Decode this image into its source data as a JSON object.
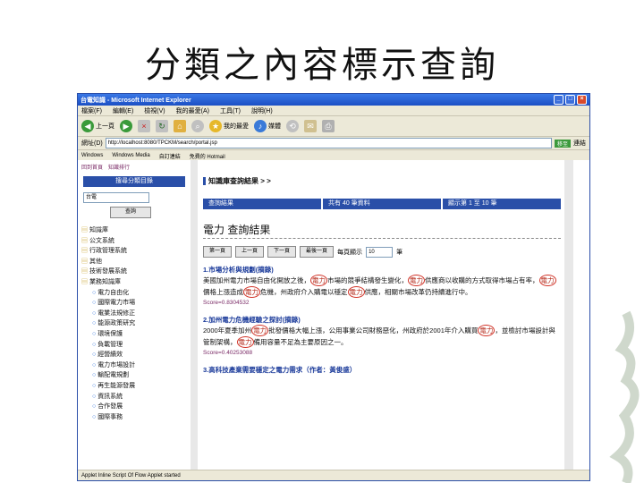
{
  "slide": {
    "title": "分類之內容標示查詢"
  },
  "window": {
    "title": "台電知識 - Microsoft Internet Explorer",
    "menu": [
      "檔案(F)",
      "編輯(E)",
      "檢視(V)",
      "我的最愛(A)",
      "工具(T)",
      "說明(H)"
    ],
    "toolbar": {
      "back": "上一頁",
      "favorites": "我的最愛",
      "media": "媒體"
    },
    "address": {
      "label": "網址(D)",
      "value": "http://localhost:8080/TPCKM/search/portal.jsp",
      "go": "移至",
      "links_label": "連結"
    },
    "links": [
      "Windows",
      "Windows Media",
      "自訂連結",
      "免費的 Hotmail"
    ],
    "status": "Applet Inline Script Of Flow Applet started"
  },
  "left": {
    "top_links": [
      "回到首頁",
      "知識排行"
    ],
    "category_header": "搜尋分類目錄",
    "category_input": "台電",
    "query_button": "查詢",
    "tree": [
      {
        "type": "fold",
        "label": "知識庫"
      },
      {
        "type": "fold",
        "label": "公文系統"
      },
      {
        "type": "fold",
        "label": "行政管理系統"
      },
      {
        "type": "fold",
        "label": "其他"
      },
      {
        "type": "fold",
        "label": "技術發展系統"
      },
      {
        "type": "fold",
        "label": "業務知識庫"
      },
      {
        "type": "leaf",
        "label": "電力自由化"
      },
      {
        "type": "leaf",
        "label": "國際電力市場"
      },
      {
        "type": "leaf",
        "label": "電業法規修正"
      },
      {
        "type": "leaf",
        "label": "能源政策研究"
      },
      {
        "type": "leaf",
        "label": "環境保護"
      },
      {
        "type": "leaf",
        "label": "負載管理"
      },
      {
        "type": "leaf",
        "label": "經營績效"
      },
      {
        "type": "leaf",
        "label": "電力市場設計"
      },
      {
        "type": "leaf",
        "label": "輸配電規劃"
      },
      {
        "type": "leaf",
        "label": "再生能源發展"
      },
      {
        "type": "leaf",
        "label": "資訊系統"
      },
      {
        "type": "leaf",
        "label": "合作發展"
      },
      {
        "type": "leaf",
        "label": "國際事務"
      }
    ]
  },
  "right": {
    "breadcrumb": "知識庫查詢結果 > >",
    "tabs": [
      "查詢結果",
      "共有 40 筆資料",
      "顯示第 1 至 10 筆"
    ],
    "result_title": "電力 查詢結果",
    "pager": {
      "first": "第一頁",
      "prev": "上一頁",
      "next": "下一頁",
      "last": "最後一頁",
      "per_page_label": "每頁顯示",
      "per_page_value": "10",
      "unit": "筆"
    },
    "results": [
      {
        "heading": "1.市場分析與規劃(摘錄)",
        "body_a": "美國加州電力市場自由化開放之後，",
        "mark1": "電力",
        "body_b": "市場的競爭結構發生變化，",
        "mark2": "電力",
        "body_c": "供應商以收購的方式取得市場占有率，",
        "mark3": "電力",
        "body_d": "價格上漲造成",
        "mark4": "電力",
        "body_e": "危機，州政府介入購電以穩定",
        "mark5": "電力",
        "body_f": "供應，相關市場改革仍持續進行中。",
        "score": "Score=0.8304532"
      },
      {
        "heading": "2.加州電力危機經驗之探討(摘錄)",
        "body_a": "2000年夏季加州",
        "mark1": "電力",
        "body_b": "批發價格大幅上漲，公用事業公司財務惡化，州政府於2001年介入購買",
        "mark2": "電力",
        "body_c": "，並檢討市場設計與管制架構，",
        "mark3": "電力",
        "body_d": "備用容量不足為主要原因之一。",
        "score": "Score=0.40253088"
      },
      {
        "heading": "3.高科技產業需要穩定之電力需求（作者：黃俊盛）",
        "score": ""
      }
    ]
  }
}
